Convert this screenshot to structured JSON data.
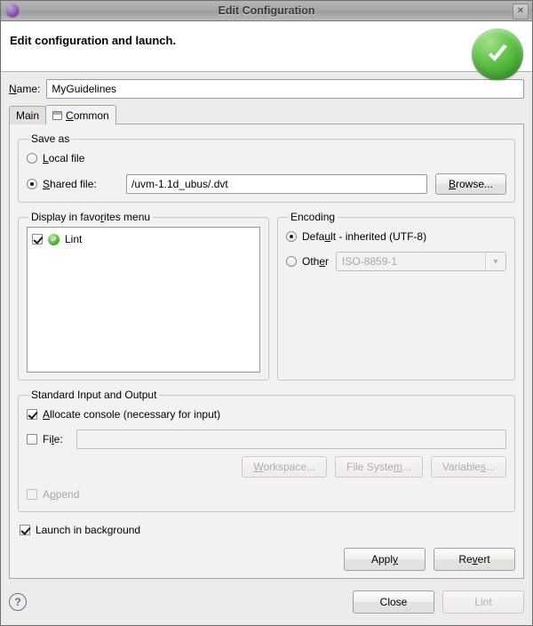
{
  "window": {
    "title": "Edit Configuration",
    "app_icon": "eclipse-sphere-icon",
    "close_label": "✕"
  },
  "banner": {
    "title": "Edit configuration and launch.",
    "status_icon": "green-check-icon"
  },
  "name_field": {
    "label": "Name:",
    "value": "MyGuidelines",
    "placeholder": ""
  },
  "tabs": [
    {
      "label": "Main",
      "active": false,
      "icon": ""
    },
    {
      "label": "Common",
      "active": true,
      "icon": "tab-window-icon"
    }
  ],
  "save_as": {
    "legend": "Save as",
    "local_file": {
      "label": "Local file",
      "selected": false
    },
    "shared_file": {
      "label": "Shared file:",
      "selected": true,
      "value": "/uvm-1.1d_ubus/.dvt",
      "placeholder": ""
    },
    "browse_label": "Browse..."
  },
  "favorites": {
    "legend": "Display in favorites menu",
    "items": [
      {
        "label": "Lint",
        "checked": true,
        "icon": "green-check-icon"
      }
    ]
  },
  "encoding": {
    "legend": "Encoding",
    "default_option": {
      "label": "Default - inherited (UTF-8)",
      "selected": true
    },
    "other_option": {
      "label": "Other",
      "selected": false
    },
    "other_value": "ISO-8859-1",
    "other_enabled": false,
    "dropdown_icon": "chevron-down-icon"
  },
  "stdio": {
    "legend": "Standard Input and Output",
    "allocate_console": {
      "label": "Allocate console (necessary for input)",
      "checked": true
    },
    "file": {
      "label": "File:",
      "checked": false,
      "value": "",
      "placeholder": ""
    },
    "workspace_label": "Workspace...",
    "file_system_label": "File System...",
    "variables_label": "Variables...",
    "append": {
      "label": "Append",
      "checked": false,
      "enabled": false
    }
  },
  "launch_in_background": {
    "label": "Launch in background",
    "checked": true
  },
  "form_buttons": {
    "apply_label": "Apply",
    "revert_label": "Revert"
  },
  "dialog_buttons": {
    "help_label": "?",
    "close_label": "Close",
    "lint_label": "Lint",
    "lint_enabled": false
  },
  "colors": {
    "accent_green": "#3d9e2c",
    "panel_bg": "#f3f2f1",
    "window_bg": "#edecea",
    "titlebar": "#a8a8a8",
    "field_bg": "#ffffff",
    "disabled_text": "#a9a7a3"
  }
}
